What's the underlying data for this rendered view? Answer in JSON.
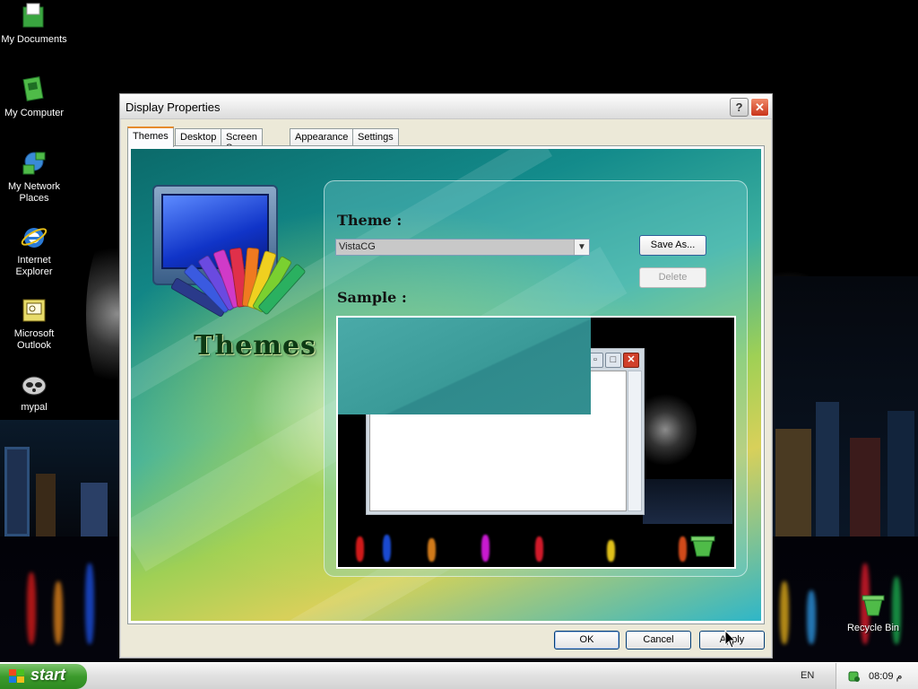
{
  "desktop": {
    "icons": [
      {
        "label": "My Documents"
      },
      {
        "label": "My Computer"
      },
      {
        "label": "My Network Places"
      },
      {
        "label": "Internet Explorer"
      },
      {
        "label": "Microsoft Outlook"
      },
      {
        "label": "mypal"
      },
      {
        "label": "Recycle Bin"
      }
    ]
  },
  "window": {
    "title": "Display Properties",
    "help_label": "?",
    "close_label": "✕",
    "tabs": [
      {
        "label": "Themes",
        "active": true
      },
      {
        "label": "Desktop"
      },
      {
        "label": "Screen Saver"
      },
      {
        "label": "Appearance"
      },
      {
        "label": "Settings"
      }
    ],
    "themes_panel": {
      "banner_text": "Themes",
      "theme_label": "Theme :",
      "theme_value": "VistaCG",
      "save_as_label": "Save As...",
      "delete_label": "Delete",
      "sample_label": "Sample :"
    },
    "buttons": {
      "ok": "OK",
      "cancel": "Cancel",
      "apply": "Apply"
    }
  },
  "taskbar": {
    "start_label": "start",
    "language": "EN",
    "clock": "08:09 م"
  }
}
